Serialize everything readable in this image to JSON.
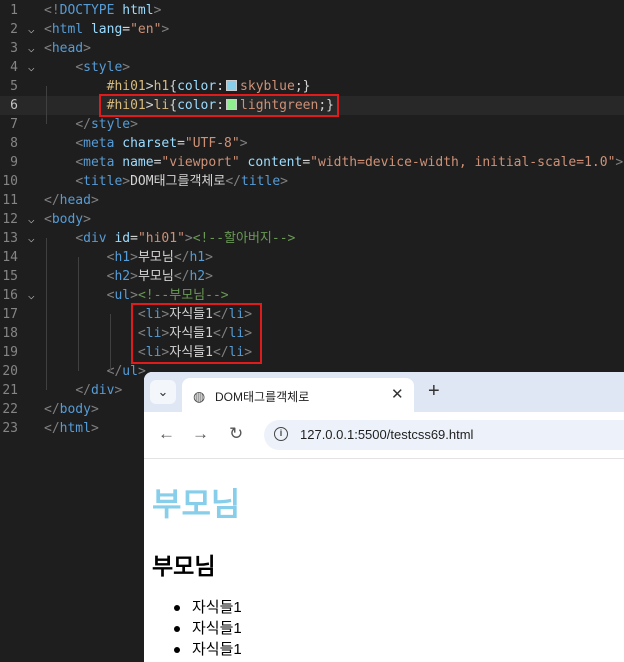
{
  "editor": {
    "lines": [
      {
        "n": "1",
        "parts": [
          [
            "br",
            "<!"
          ],
          [
            "tag",
            "DOCTYPE"
          ],
          [
            "txt",
            " "
          ],
          [
            "attr",
            "html"
          ],
          [
            "br",
            ">"
          ]
        ]
      },
      {
        "n": "2",
        "fold": "⌵",
        "parts": [
          [
            "br",
            "<"
          ],
          [
            "tag",
            "html"
          ],
          [
            "txt",
            " "
          ],
          [
            "attr",
            "lang"
          ],
          [
            "txt",
            "="
          ],
          [
            "str",
            "\"en\""
          ],
          [
            "br",
            ">"
          ]
        ]
      },
      {
        "n": "3",
        "fold": "⌵",
        "parts": [
          [
            "br",
            "<"
          ],
          [
            "tag",
            "head"
          ],
          [
            "br",
            ">"
          ]
        ]
      },
      {
        "n": "4",
        "fold": "⌵",
        "parts": [
          [
            "txt",
            "    "
          ],
          [
            "br",
            "<"
          ],
          [
            "tag",
            "style"
          ],
          [
            "br",
            ">"
          ]
        ]
      },
      {
        "n": "5",
        "parts": [
          [
            "txt",
            "        "
          ],
          [
            "sel",
            "#hi01"
          ],
          [
            "punc",
            ">"
          ],
          [
            "sel",
            "h1"
          ],
          [
            "punc",
            "{"
          ],
          [
            "prop",
            "color"
          ],
          [
            "punc",
            ":"
          ],
          [
            "swatch",
            "#87ceeb"
          ],
          [
            "val",
            "skyblue"
          ],
          [
            "punc",
            ";}"
          ]
        ]
      },
      {
        "n": "6",
        "active": true,
        "parts": [
          [
            "txt",
            "        "
          ],
          [
            "sel",
            "#hi01"
          ],
          [
            "punc",
            ">"
          ],
          [
            "sel",
            "li"
          ],
          [
            "punc",
            "{"
          ],
          [
            "prop",
            "color"
          ],
          [
            "punc",
            ":"
          ],
          [
            "swatch",
            "#90ee90"
          ],
          [
            "val",
            "lightgreen"
          ],
          [
            "punc",
            ";}"
          ]
        ]
      },
      {
        "n": "7",
        "parts": [
          [
            "txt",
            "    "
          ],
          [
            "br",
            "</"
          ],
          [
            "tag",
            "style"
          ],
          [
            "br",
            ">"
          ]
        ]
      },
      {
        "n": "8",
        "parts": [
          [
            "txt",
            "    "
          ],
          [
            "br",
            "<"
          ],
          [
            "tag",
            "meta"
          ],
          [
            "txt",
            " "
          ],
          [
            "attr",
            "charset"
          ],
          [
            "txt",
            "="
          ],
          [
            "str",
            "\"UTF-8\""
          ],
          [
            "br",
            ">"
          ]
        ]
      },
      {
        "n": "9",
        "parts": [
          [
            "txt",
            "    "
          ],
          [
            "br",
            "<"
          ],
          [
            "tag",
            "meta"
          ],
          [
            "txt",
            " "
          ],
          [
            "attr",
            "name"
          ],
          [
            "txt",
            "="
          ],
          [
            "str",
            "\"viewport\""
          ],
          [
            "txt",
            " "
          ],
          [
            "attr",
            "content"
          ],
          [
            "txt",
            "="
          ],
          [
            "str",
            "\"width=device-width, initial-scale=1.0\""
          ],
          [
            "br",
            ">"
          ]
        ]
      },
      {
        "n": "10",
        "parts": [
          [
            "txt",
            "    "
          ],
          [
            "br",
            "<"
          ],
          [
            "tag",
            "title"
          ],
          [
            "br",
            ">"
          ],
          [
            "txt",
            "DOM태그를객체로"
          ],
          [
            "br",
            "</"
          ],
          [
            "tag",
            "title"
          ],
          [
            "br",
            ">"
          ]
        ]
      },
      {
        "n": "11",
        "parts": [
          [
            "br",
            "</"
          ],
          [
            "tag",
            "head"
          ],
          [
            "br",
            ">"
          ]
        ]
      },
      {
        "n": "12",
        "fold": "⌵",
        "parts": [
          [
            "br",
            "<"
          ],
          [
            "tag",
            "body"
          ],
          [
            "br",
            ">"
          ]
        ]
      },
      {
        "n": "13",
        "fold": "⌵",
        "parts": [
          [
            "txt",
            "    "
          ],
          [
            "br",
            "<"
          ],
          [
            "tag",
            "div"
          ],
          [
            "txt",
            " "
          ],
          [
            "attr",
            "id"
          ],
          [
            "txt",
            "="
          ],
          [
            "str",
            "\"hi01\""
          ],
          [
            "br",
            ">"
          ],
          [
            "cmt",
            "<!--할아버지-->"
          ]
        ]
      },
      {
        "n": "14",
        "parts": [
          [
            "txt",
            "        "
          ],
          [
            "br",
            "<"
          ],
          [
            "tag",
            "h1"
          ],
          [
            "br",
            ">"
          ],
          [
            "txt",
            "부모님"
          ],
          [
            "br",
            "</"
          ],
          [
            "tag",
            "h1"
          ],
          [
            "br",
            ">"
          ]
        ]
      },
      {
        "n": "15",
        "parts": [
          [
            "txt",
            "        "
          ],
          [
            "br",
            "<"
          ],
          [
            "tag",
            "h2"
          ],
          [
            "br",
            ">"
          ],
          [
            "txt",
            "부모님"
          ],
          [
            "br",
            "</"
          ],
          [
            "tag",
            "h2"
          ],
          [
            "br",
            ">"
          ]
        ]
      },
      {
        "n": "16",
        "fold": "⌵",
        "parts": [
          [
            "txt",
            "        "
          ],
          [
            "br",
            "<"
          ],
          [
            "tag",
            "ul"
          ],
          [
            "br",
            ">"
          ],
          [
            "cmt",
            "<!--부모님-->"
          ]
        ]
      },
      {
        "n": "17",
        "parts": [
          [
            "txt",
            "            "
          ],
          [
            "br",
            "<"
          ],
          [
            "tag",
            "li"
          ],
          [
            "br",
            ">"
          ],
          [
            "txt",
            "자식들1"
          ],
          [
            "br",
            "</"
          ],
          [
            "tag",
            "li"
          ],
          [
            "br",
            ">"
          ]
        ]
      },
      {
        "n": "18",
        "parts": [
          [
            "txt",
            "            "
          ],
          [
            "br",
            "<"
          ],
          [
            "tag",
            "li"
          ],
          [
            "br",
            ">"
          ],
          [
            "txt",
            "자식들1"
          ],
          [
            "br",
            "</"
          ],
          [
            "tag",
            "li"
          ],
          [
            "br",
            ">"
          ]
        ]
      },
      {
        "n": "19",
        "parts": [
          [
            "txt",
            "            "
          ],
          [
            "br",
            "<"
          ],
          [
            "tag",
            "li"
          ],
          [
            "br",
            ">"
          ],
          [
            "txt",
            "자식들1"
          ],
          [
            "br",
            "</"
          ],
          [
            "tag",
            "li"
          ],
          [
            "br",
            ">"
          ]
        ]
      },
      {
        "n": "20",
        "parts": [
          [
            "txt",
            "        "
          ],
          [
            "br",
            "</"
          ],
          [
            "tag",
            "ul"
          ],
          [
            "br",
            ">"
          ]
        ]
      },
      {
        "n": "21",
        "parts": [
          [
            "txt",
            "    "
          ],
          [
            "br",
            "</"
          ],
          [
            "tag",
            "div"
          ],
          [
            "br",
            ">"
          ]
        ]
      },
      {
        "n": "22",
        "parts": [
          [
            "br",
            "</"
          ],
          [
            "tag",
            "body"
          ],
          [
            "br",
            ">"
          ]
        ]
      },
      {
        "n": "23",
        "parts": [
          [
            "br",
            "</"
          ],
          [
            "tag",
            "html"
          ],
          [
            "br",
            ">"
          ]
        ]
      }
    ]
  },
  "browser": {
    "tab_dropdown_icon": "chevron-down-icon",
    "tab_dropdown_glyph": "⌄",
    "tab": {
      "title": "DOM태그를객체로",
      "favicon": "globe-icon",
      "favicon_glyph": "◍",
      "close": "✕"
    },
    "new_tab": "+",
    "nav": {
      "back": "←",
      "forward": "→",
      "reload": "↻"
    },
    "omnibox": {
      "info_glyph": "i",
      "url": "127.0.0.1:5500/testcss69.html"
    },
    "page": {
      "h1": "부모님",
      "h2": "부모님",
      "items": [
        "자식들1",
        "자식들1",
        "자식들1"
      ]
    }
  },
  "colors": {
    "highlight_box": "#e01b1b",
    "h1_color": "#87ceeb",
    "li_color_in_code": "#90ee90"
  }
}
